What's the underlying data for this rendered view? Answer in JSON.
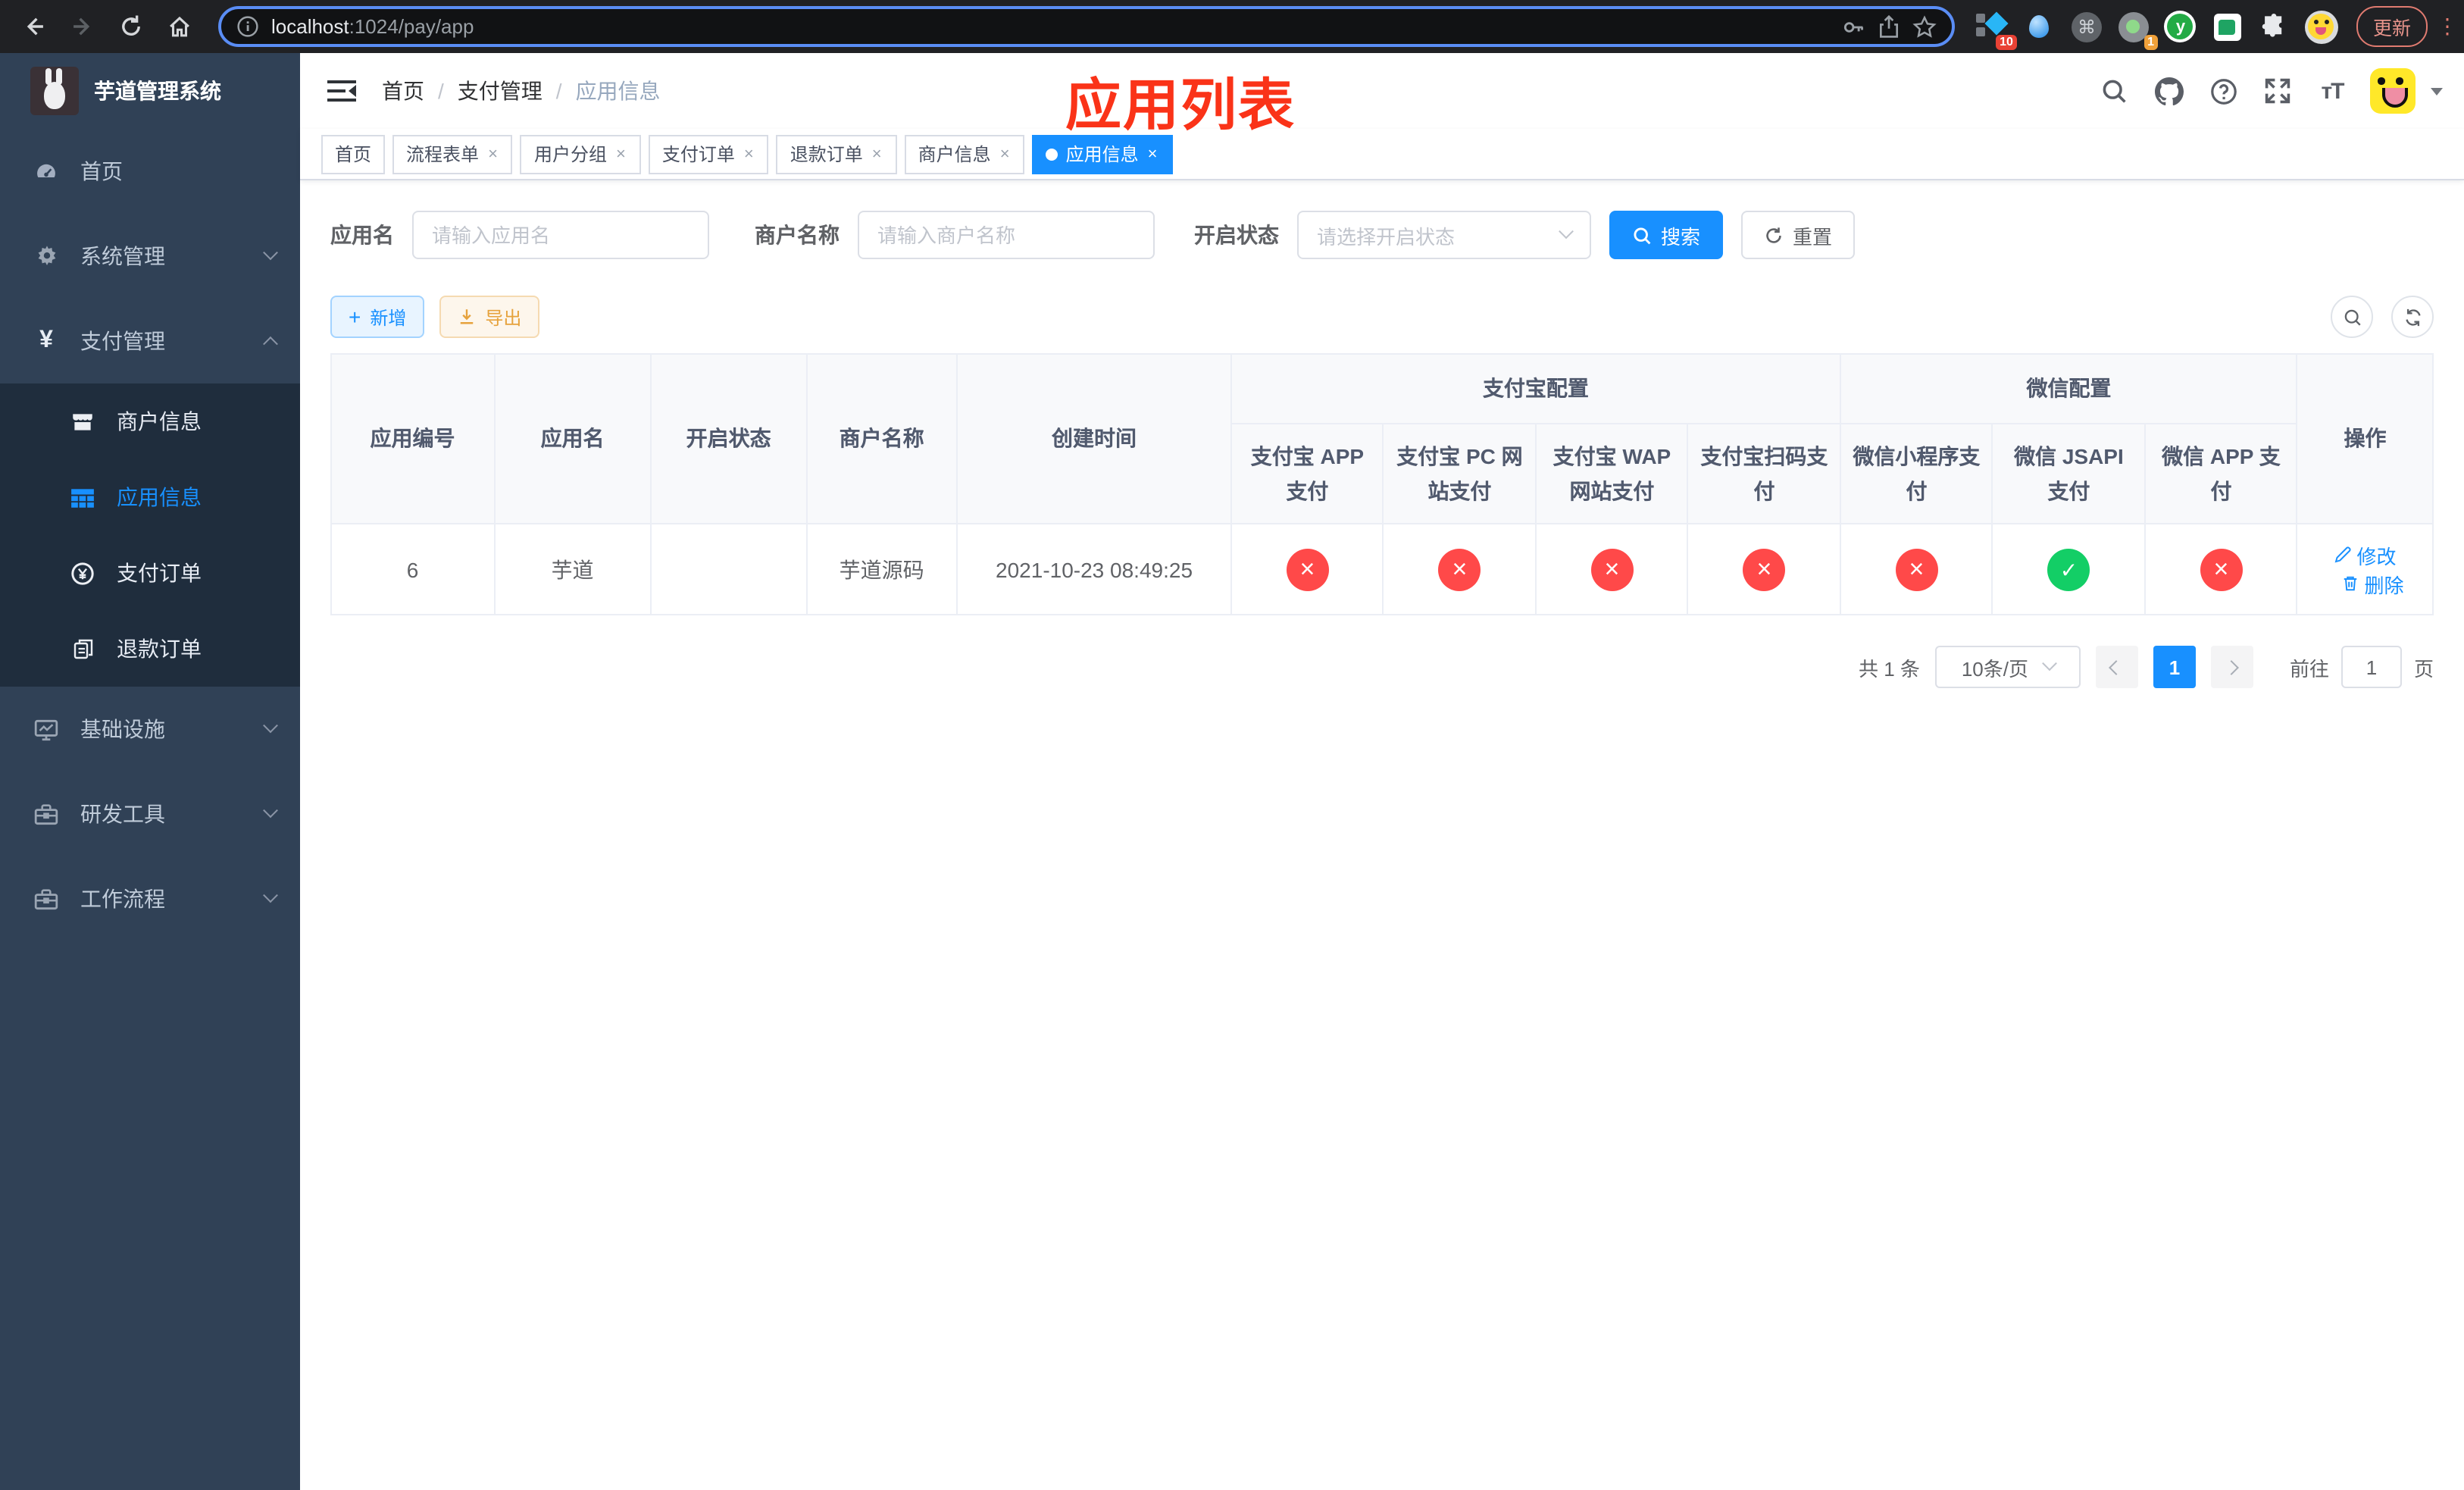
{
  "browser": {
    "url_host": "localhost",
    "url_rest": ":1024/pay/app",
    "update_label": "更新",
    "ext_badge_diamond": "10",
    "ext_badge_record": "1",
    "ext_y_letter": "y",
    "ext_cmd_glyph": "⌘"
  },
  "sidebar": {
    "title": "芋道管理系统",
    "items": [
      {
        "label": "首页",
        "icon": "dashboard-icon"
      },
      {
        "label": "系统管理",
        "icon": "gear-icon",
        "chevron": "down"
      },
      {
        "label": "支付管理",
        "icon": "yen-icon",
        "chevron": "up",
        "children": [
          {
            "label": "商户信息",
            "icon": "store-icon"
          },
          {
            "label": "应用信息",
            "icon": "grid-icon",
            "active": true
          },
          {
            "label": "支付订单",
            "icon": "coin-icon"
          },
          {
            "label": "退款订单",
            "icon": "copy-icon"
          }
        ]
      },
      {
        "label": "基础设施",
        "icon": "monitor-icon",
        "chevron": "down"
      },
      {
        "label": "研发工具",
        "icon": "toolbox-icon",
        "chevron": "down"
      },
      {
        "label": "工作流程",
        "icon": "toolbox-icon",
        "chevron": "down"
      }
    ]
  },
  "header": {
    "breadcrumb": [
      "首页",
      "支付管理",
      "应用信息"
    ],
    "annotation": "应用列表"
  },
  "tabs": [
    {
      "label": "首页",
      "closable": false
    },
    {
      "label": "流程表单",
      "closable": true
    },
    {
      "label": "用户分组",
      "closable": true
    },
    {
      "label": "支付订单",
      "closable": true
    },
    {
      "label": "退款订单",
      "closable": true
    },
    {
      "label": "商户信息",
      "closable": true
    },
    {
      "label": "应用信息",
      "closable": true,
      "active": true
    }
  ],
  "filter": {
    "app_name_label": "应用名",
    "app_name_placeholder": "请输入应用名",
    "merchant_label": "商户名称",
    "merchant_placeholder": "请输入商户名称",
    "status_label": "开启状态",
    "status_placeholder": "请选择开启状态",
    "search_label": "搜索",
    "reset_label": "重置"
  },
  "toolbar": {
    "add_label": "新增",
    "export_label": "导出"
  },
  "table": {
    "col_app_id": "应用编号",
    "col_app_name": "应用名",
    "col_status": "开启状态",
    "col_merchant": "商户名称",
    "col_create_time": "创建时间",
    "group_alipay": "支付宝配置",
    "group_wechat": "微信配置",
    "col_actions": "操作",
    "sub_columns": [
      "支付宝 APP 支付",
      "支付宝 PC 网站支付",
      "支付宝 WAP 网站支付",
      "支付宝扫码支付",
      "微信小程序支付",
      "微信 JSAPI 支付",
      "微信 APP 支付"
    ],
    "row": {
      "app_id": "6",
      "app_name": "芋道",
      "status_on": true,
      "merchant": "芋道源码",
      "create_time": "2021-10-23 08:49:25",
      "channels": [
        false,
        false,
        false,
        false,
        false,
        true,
        false
      ],
      "edit_label": "修改",
      "delete_label": "删除"
    }
  },
  "pagination": {
    "total": "共 1 条",
    "page_size": "10条/页",
    "page": "1",
    "goto_label": "前往",
    "goto_value": "1",
    "unit_label": "页"
  },
  "colors": {
    "primary": "#1890ff",
    "success": "#13ce66",
    "danger": "#ff4949",
    "warning": "#e6a23c",
    "sidebar_bg": "#304156",
    "submenu_bg": "#1f2d3d",
    "annotation_red": "#fa3318"
  }
}
